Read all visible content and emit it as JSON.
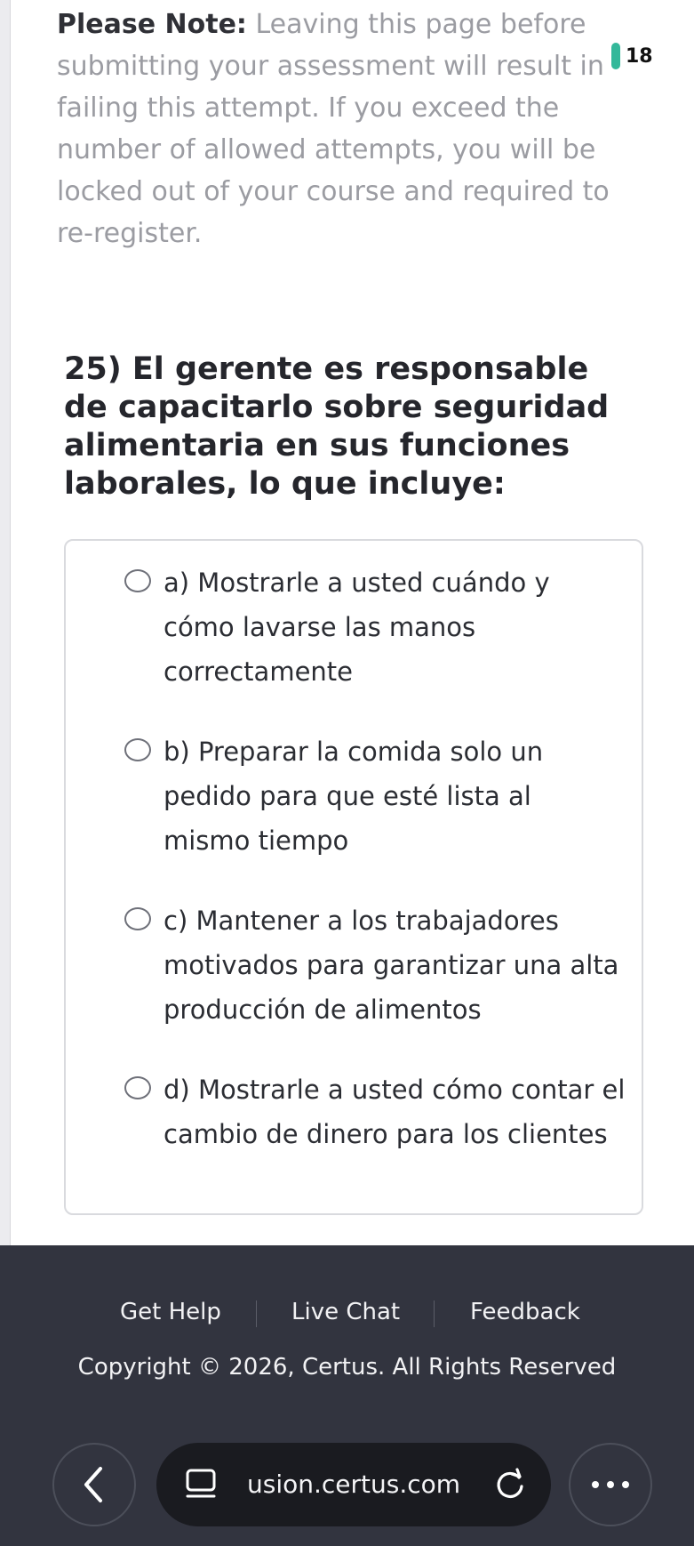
{
  "notice": {
    "label": "Please Note:",
    "text": "Leaving this page before submitting your assessment will result in failing this attempt. If you exceed the number of allowed attempts, you will be locked out of your course and required to re-register."
  },
  "status_indicator": {
    "count": "18",
    "color": "#33b89a"
  },
  "question": {
    "text": "25) El gerente es responsable de capacitarlo sobre seguridad alimentaria en sus funciones laborales, lo que incluye:",
    "options": [
      {
        "label": "a) Mostrarle a usted cuándo y cómo lavarse las manos correctamente",
        "selected": false
      },
      {
        "label": "b) Preparar la comida solo un pedido para que esté lista al mismo tiempo",
        "selected": false
      },
      {
        "label": "c) Mantener a los trabajadores motivados para garantizar una alta producción de alimentos",
        "selected": false
      },
      {
        "label": "d) Mostrarle a usted cómo contar el cambio de dinero para los clientes",
        "selected": false
      }
    ]
  },
  "footer": {
    "links": [
      "Get Help",
      "Live Chat",
      "Feedback"
    ],
    "copyright": "Copyright © 2026, Certus. All Rights Reserved"
  },
  "browser": {
    "url": "usion.certus.com",
    "back_icon": "chevron-left-icon",
    "tabs_icon": "tabs-icon",
    "reload_icon": "reload-icon",
    "more_icon": "more-icon"
  },
  "colors": {
    "footer_bg": "#32343f",
    "url_bar_bg": "#1a1b20",
    "accent": "#33b89a"
  }
}
